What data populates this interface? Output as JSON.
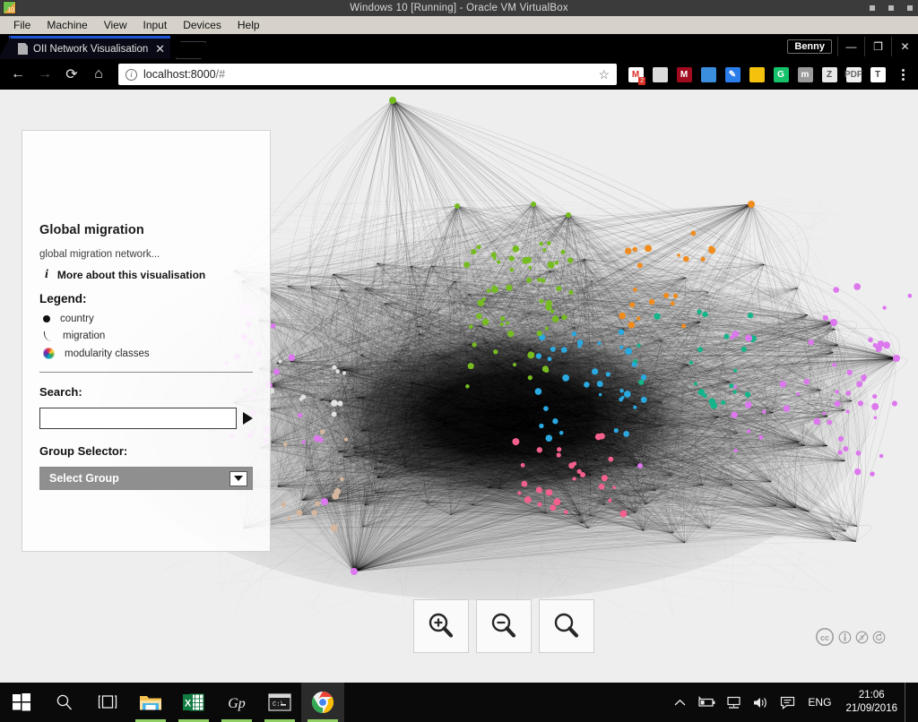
{
  "vbox": {
    "title": "Windows 10 [Running] - Oracle VM VirtualBox",
    "icon": "windows10-icon",
    "menus": [
      "File",
      "Machine",
      "View",
      "Input",
      "Devices",
      "Help"
    ],
    "window_buttons": [
      "minimize",
      "restore",
      "close"
    ]
  },
  "browser": {
    "tab": {
      "title": "OII Network Visualisation",
      "favicon": "page-icon",
      "close": "✕"
    },
    "new_tab": "+",
    "profile_name": "Benny",
    "window_controls": {
      "minimize": "—",
      "maximize": "❐",
      "close": "✕"
    },
    "nav": {
      "back": "←",
      "forward": "→",
      "reload": "⟳",
      "home": "⌂"
    },
    "omnibox": {
      "info_icon": "i",
      "url_host": "localhost:8000",
      "url_path": "/#",
      "star_icon": "☆"
    },
    "extensions": [
      {
        "name": "gmail-extension",
        "label": "M",
        "color": "#ffffff",
        "text_color": "#d93025",
        "badge": "2"
      },
      {
        "name": "document-extension",
        "label": "",
        "color": "#dcdcdc",
        "text_color": "#777777",
        "badge": ""
      },
      {
        "name": "mendeley-extension",
        "label": "M",
        "color": "#a00b1e",
        "text_color": "#ffffff",
        "badge": ""
      },
      {
        "name": "diamond-extension",
        "label": "",
        "color": "#3b8ede",
        "text_color": "#ffffff",
        "badge": ""
      },
      {
        "name": "docs-extension",
        "label": "✎",
        "color": "#2b7de9",
        "text_color": "#ffffff",
        "badge": ""
      },
      {
        "name": "google-drive-extension",
        "label": "",
        "color": "#f4c20d",
        "text_color": "#ffffff",
        "badge": ""
      },
      {
        "name": "grammarly-extension",
        "label": "G",
        "color": "#15c26b",
        "text_color": "#ffffff",
        "badge": ""
      },
      {
        "name": "medium-extension",
        "label": "m",
        "color": "#9a9a9a",
        "text_color": "#ffffff",
        "badge": ""
      },
      {
        "name": "zotero-extension",
        "label": "Z",
        "color": "#e8e8e8",
        "text_color": "#555555",
        "badge": ""
      },
      {
        "name": "pdf-extension",
        "label": "PDF",
        "color": "#efefef",
        "text_color": "#6a6a6a",
        "badge": ""
      },
      {
        "name": "translate-extension",
        "label": "T",
        "color": "#ffffff",
        "text_color": "#444444",
        "badge": ""
      }
    ],
    "menu_icon": "kebab-menu-icon"
  },
  "panel": {
    "title": "Global migration",
    "description": "global migration network...",
    "more_link": "More about this visualisation",
    "more_icon": "info-italic-icon",
    "legend_heading": "Legend:",
    "legend": [
      {
        "key": "country",
        "icon": "black-dot-icon"
      },
      {
        "key": "migration",
        "icon": "curve-line-icon"
      },
      {
        "key": "modularity classes",
        "icon": "color-wheel-icon"
      }
    ],
    "search_label": "Search:",
    "search_value": "",
    "search_placeholder": "",
    "search_go_icon": "play-triangle-icon",
    "group_label": "Group Selector:",
    "group_selected": "Select Group",
    "group_arrow_icon": "chevron-down-icon"
  },
  "zoom_controls": [
    {
      "name": "zoom-in-button",
      "icon": "magnifier-plus-icon"
    },
    {
      "name": "zoom-out-button",
      "icon": "magnifier-minus-icon"
    },
    {
      "name": "zoom-reset-button",
      "icon": "magnifier-icon"
    }
  ],
  "license": {
    "name": "creative-commons-badge",
    "icons": [
      "cc-icon",
      "by-icon",
      "nc-icon",
      "sa-icon"
    ]
  },
  "graph": {
    "background": "#eeeeee",
    "edge_color": "#000000",
    "node_colors": {
      "green": "#76bc21",
      "orange": "#f08c1e",
      "magenta": "#dd77ee",
      "cyan": "#2aa8e0",
      "teal": "#14b58a",
      "pink": "#f4608e",
      "white": "#e2e2e2",
      "tan": "#d6b79e"
    }
  },
  "taskbar": {
    "items": [
      {
        "name": "start-button",
        "icon": "windows-logo-icon",
        "active": false,
        "open": false
      },
      {
        "name": "search-button",
        "icon": "search-icon",
        "active": false,
        "open": false
      },
      {
        "name": "task-view-button",
        "icon": "task-view-icon",
        "active": false,
        "open": false
      },
      {
        "name": "file-explorer-button",
        "icon": "folder-icon",
        "active": false,
        "open": true
      },
      {
        "name": "excel-button",
        "icon": "excel-icon",
        "active": false,
        "open": true
      },
      {
        "name": "gephi-button",
        "icon": "gephi-icon",
        "active": false,
        "open": true
      },
      {
        "name": "command-prompt-button",
        "icon": "terminal-icon",
        "active": false,
        "open": true
      },
      {
        "name": "chrome-button",
        "icon": "chrome-icon",
        "active": true,
        "open": true
      }
    ],
    "tray": [
      {
        "name": "show-hidden-icons",
        "icon": "chevron-up-icon"
      },
      {
        "name": "battery-icon",
        "icon": "battery-icon"
      },
      {
        "name": "network-icon",
        "icon": "network-icon"
      },
      {
        "name": "volume-icon",
        "icon": "speaker-icon"
      },
      {
        "name": "action-center-icon",
        "icon": "speech-bubble-icon"
      }
    ],
    "language": "ENG",
    "time": "21:06",
    "date": "21/09/2016"
  }
}
